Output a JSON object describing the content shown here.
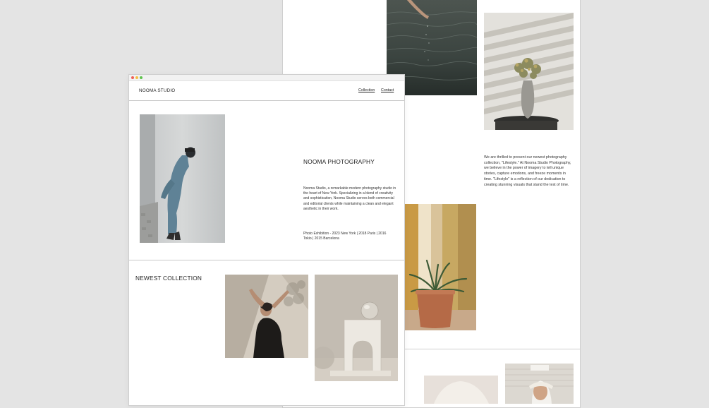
{
  "back_window": {
    "description": "We are thrilled to present our newest photography collection, \"Lifestyle.\" At Nooma Studio Photography, we believe in the power of imagery to tell unique stories, capture emotions, and freeze moments in time. \"Lifestyle\" is a reflection of our dedication to creating stunning visuals that stand the test of time."
  },
  "front_window": {
    "brand": "NOOMA STUDIO",
    "nav": {
      "collection": "Collection",
      "contact": "Contact"
    },
    "hero": {
      "title": "NOOMA PHOTOGRAPHY",
      "description": "Nooma Studio, a remarkable modern photography studio in the heart of New York. Specializing in a blend of creativity and sophistication, Nooma Studio serves both commercial and editorial clients while maintaining a clean and elegant aesthetic in their work.",
      "exhibitions": "Photo Exhibition - 2023 New York | 2018 Paris | 2016 Tokio | 2015 Barcelona"
    },
    "collection": {
      "heading": "NEWEST COLLECTION"
    }
  }
}
